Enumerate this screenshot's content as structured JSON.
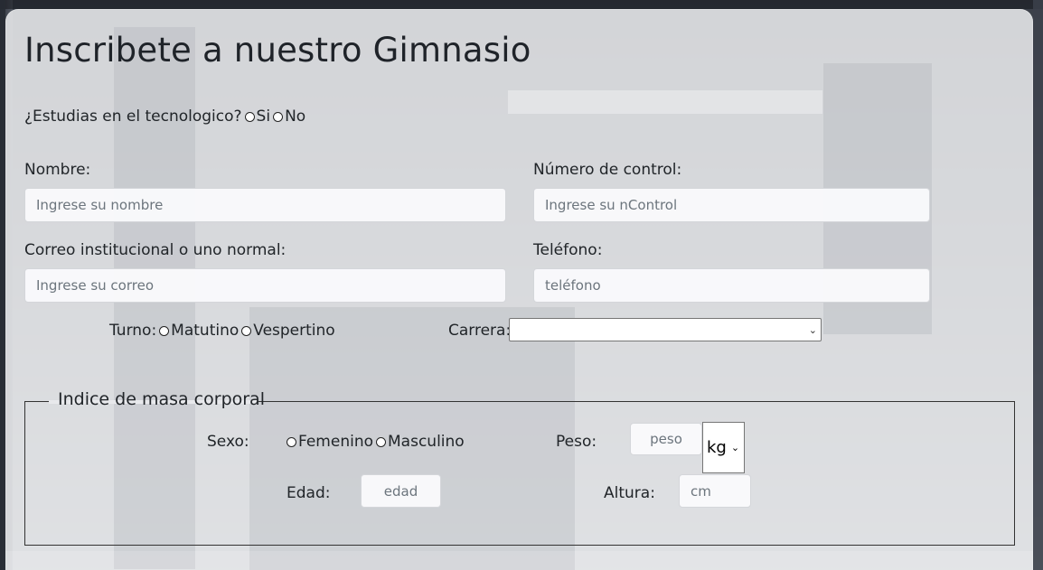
{
  "form": {
    "title": "Inscribete a nuestro Gimnasio",
    "student_question": "¿Estudias en el tecnologico?",
    "student_options": [
      "Si",
      "No"
    ],
    "nombre_label": "Nombre:",
    "nombre_placeholder": "Ingrese su nombre",
    "ncontrol_label": "Número de control:",
    "ncontrol_placeholder": "Ingrese su nControl",
    "correo_label": "Correo institucional o uno normal:",
    "correo_placeholder": "Ingrese su correo",
    "telefono_label": "Teléfono:",
    "telefono_placeholder": "teléfono",
    "turno_label": "Turno:",
    "turno_options": [
      "Matutino",
      "Vespertino"
    ],
    "carrera_label": "Carrera:",
    "carrera_value": ""
  },
  "imc": {
    "legend": "Indice de masa corporal",
    "sexo_label": "Sexo:",
    "sexo_options": [
      "Femenino",
      "Masculino"
    ],
    "peso_label": "Peso:",
    "peso_placeholder": "peso",
    "peso_unit": "kg",
    "edad_label": "Edad:",
    "edad_placeholder": "edad",
    "altura_label": "Altura:",
    "altura_placeholder": "cm"
  }
}
